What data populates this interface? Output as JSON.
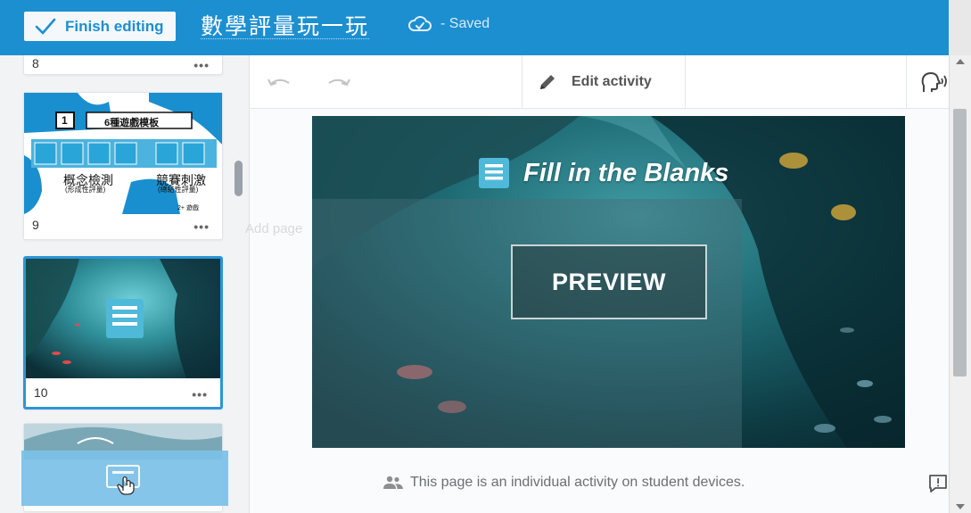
{
  "header": {
    "finish_label": "Finish editing",
    "title": "數學評量玩一玩",
    "saved_label": "- Saved",
    "brand_color": "#1c8fd1"
  },
  "slides": [
    {
      "number": "8",
      "menu": "•••"
    },
    {
      "number": "9",
      "menu": "•••",
      "thumb_badge": "1",
      "thumb_title": "6種遊戲模板",
      "thumb_left_label": "概念檢測",
      "thumb_left_sub": "(形成性評量)",
      "thumb_right_label": "競賽刺激",
      "thumb_right_sub": "(總結性評量)",
      "thumb_footer": "2+ 遊戲"
    },
    {
      "number": "10",
      "menu": "•••",
      "selected": true
    },
    {
      "number": ""
    }
  ],
  "toolbar": {
    "edit_activity_label": "Edit activity"
  },
  "main": {
    "activity_title": "Fill in the Blanks",
    "preview_label": "PREVIEW",
    "footer_note": "This page is an individual activity on student devices.",
    "ghost_add_page": "Add page"
  },
  "icons": {
    "check": "check-icon",
    "cloud": "cloud-check-icon",
    "pencil": "pencil-icon",
    "voice": "voice-icon",
    "people": "people-icon",
    "feedback": "feedback-icon",
    "document": "document-icon",
    "undo": "undo-icon",
    "redo": "redo-icon",
    "cursor": "hand-cursor-icon"
  }
}
